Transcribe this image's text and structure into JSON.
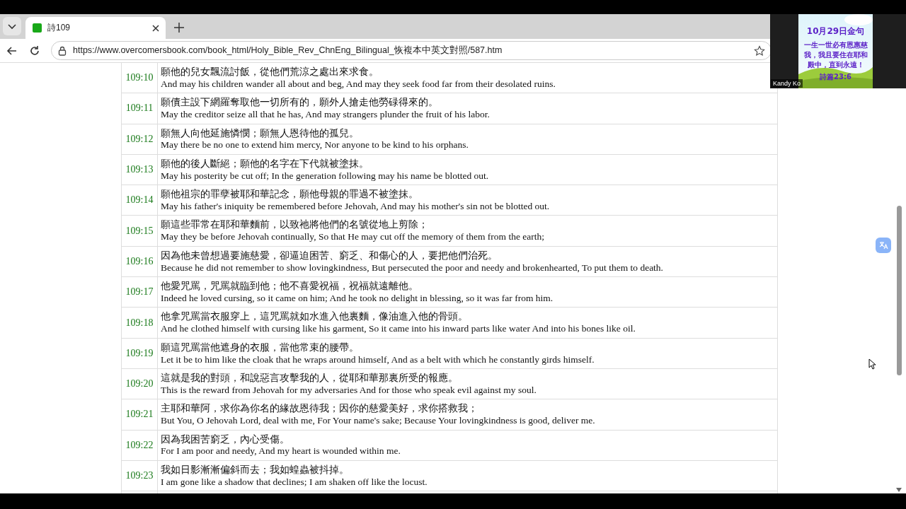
{
  "tab": {
    "title": "詩109"
  },
  "address_bar": {
    "url": "https://www.overcomersbook.com/book_html/Holy_Bible_Rev_ChnEng_Bilingual_恢複本中英文對照/587.htm"
  },
  "verses": [
    {
      "number": "109:10",
      "chinese": "願他的兒女飄流討飯，從他們荒涼之處出來求食。",
      "english": "And may his children wander all about and beg, And may they seek food far from their desolated ruins."
    },
    {
      "number": "109:11",
      "chinese": "願債主設下網羅奪取他一切所有的，願外人搶走他勞碌得來的。",
      "english": "May the creditor seize all that he has, And may strangers plunder the fruit of his labor."
    },
    {
      "number": "109:12",
      "chinese": "願無人向他延施憐憫；願無人恩待他的孤兒。",
      "english": "May there be no one to extend him mercy, Nor anyone to be kind to his orphans."
    },
    {
      "number": "109:13",
      "chinese": "願他的後人斷絕；願他的名字在下代就被塗抹。",
      "english": "May his posterity be cut off; In the generation following may his name be blotted out."
    },
    {
      "number": "109:14",
      "chinese": "願他祖宗的罪孽被耶和華記念，願他母親的罪過不被塗抹。",
      "english": "May his father's iniquity be remembered before Jehovah, And may his mother's sin not be blotted out."
    },
    {
      "number": "109:15",
      "chinese": "願這些罪常在耶和華麵前，以致祂將他們的名號從地上剪除；",
      "english": "May they be before Jehovah continually, So that He may cut off the memory of them from the earth;"
    },
    {
      "number": "109:16",
      "chinese": "因為他未曾想過要施慈愛，卻逼迫困苦、窮乏、和傷心的人，要把他們治死。",
      "english": "Because he did not remember to show lovingkindness, But persecuted the poor and needy and brokenhearted, To put them to death."
    },
    {
      "number": "109:17",
      "chinese": "他愛咒罵，咒罵就臨到他；他不喜愛祝福，祝福就遠離他。",
      "english": "Indeed he loved cursing, so it came on him; And he took no delight in blessing, so it was far from him."
    },
    {
      "number": "109:18",
      "chinese": "他拿咒罵當衣服穿上，這咒罵就如水進入他裏麵，像油進入他的骨頭。",
      "english": "And he clothed himself with cursing like his garment, So it came into his inward parts like water And into his bones like oil."
    },
    {
      "number": "109:19",
      "chinese": "願這咒罵當他遮身的衣服，當他常束的腰帶。",
      "english": "Let it be to him like the cloak that he wraps around himself, And as a belt with which he constantly girds himself."
    },
    {
      "number": "109:20",
      "chinese": "這就是我的對頭，和說惡言攻擊我的人，從耶和華那裏所受的報應。",
      "english": "This is the reward from Jehovah for my adversaries And for those who speak evil against my soul."
    },
    {
      "number": "109:21",
      "chinese": "主耶和華阿，求你為你名的緣故恩待我；因你的慈愛美好，求你搭救我；",
      "english": "But You, O Jehovah Lord, deal with me, For Your name's sake; Because Your lovingkindness is good, deliver me."
    },
    {
      "number": "109:22",
      "chinese": "因為我困苦窮乏，內心受傷。",
      "english": "For I am poor and needy, And my heart is wounded within me."
    },
    {
      "number": "109:23",
      "chinese": "我如日影漸漸偏斜而去；我如蝗蟲被抖掉。",
      "english": "I am gone like a shadow that declines; I am shaken off like the locust."
    }
  ],
  "video_tile": {
    "name": "Kandy Ko",
    "slide": {
      "title": "10月29日金句",
      "lines": [
        "一生一世必有恩惠慈",
        "我，我且要住在耶和",
        "殿中，直到永遠！"
      ],
      "reference": "詩篇23:6"
    }
  }
}
